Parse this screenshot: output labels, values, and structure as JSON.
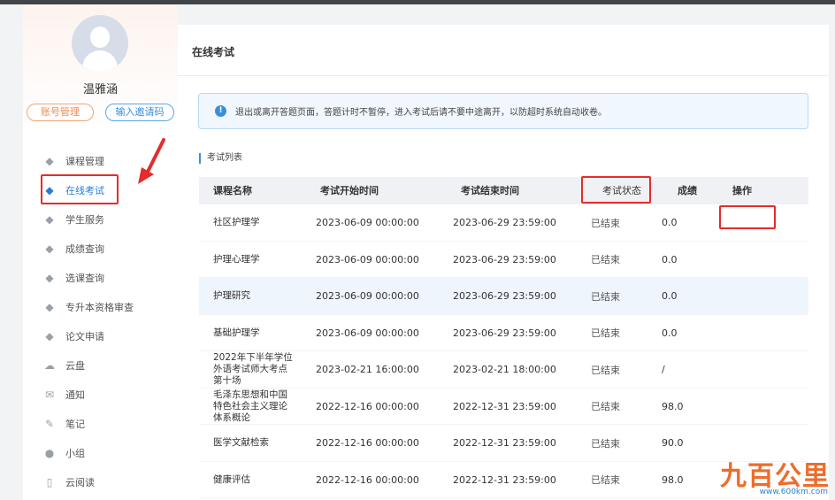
{
  "sidebar": {
    "username": "温雅涵",
    "account_button": "账号管理",
    "invite_button": "输入邀请码",
    "items": [
      {
        "label": "课程管理",
        "icon": "graduation-cap-icon",
        "active": false
      },
      {
        "label": "在线考试",
        "icon": "graduation-cap-icon",
        "active": true
      },
      {
        "label": "学生服务",
        "icon": "graduation-cap-icon",
        "active": false
      },
      {
        "label": "成绩查询",
        "icon": "graduation-cap-icon",
        "active": false
      },
      {
        "label": "选课查询",
        "icon": "graduation-cap-icon",
        "active": false
      },
      {
        "label": "专升本资格审查",
        "icon": "graduation-cap-icon",
        "active": false
      },
      {
        "label": "论文申请",
        "icon": "graduation-cap-icon",
        "active": false
      },
      {
        "label": "云盘",
        "icon": "cloud-icon",
        "active": false
      },
      {
        "label": "通知",
        "icon": "mail-icon",
        "active": false
      },
      {
        "label": "笔记",
        "icon": "note-icon",
        "active": false
      },
      {
        "label": "小组",
        "icon": "user-icon",
        "active": false
      },
      {
        "label": "云阅读",
        "icon": "book-icon",
        "active": false
      }
    ]
  },
  "main": {
    "title": "在线考试",
    "notice": "退出或离开答题页面，答题计时不暂停，进入考试后请不要中途离开，以防超时系统自动收卷。",
    "section_label": "考试列表",
    "columns": [
      "课程名称",
      "考试开始时间",
      "考试结束时间",
      "考试状态",
      "成绩",
      "操作"
    ],
    "rows": [
      {
        "name": "社区护理学",
        "start": "2023-06-09 00:00:00",
        "end": "2023-06-29 23:59:00",
        "status": "已结束",
        "score": "0.0"
      },
      {
        "name": "护理心理学",
        "start": "2023-06-09 00:00:00",
        "end": "2023-06-29 23:59:00",
        "status": "已结束",
        "score": "0.0"
      },
      {
        "name": "护理研究",
        "start": "2023-06-09 00:00:00",
        "end": "2023-06-29 23:59:00",
        "status": "已结束",
        "score": "0.0"
      },
      {
        "name": "基础护理学",
        "start": "2023-06-09 00:00:00",
        "end": "2023-06-29 23:59:00",
        "status": "已结束",
        "score": "0.0"
      },
      {
        "name": "2022年下半年学位外语考试师大考点第十场",
        "start": "2023-02-21 16:00:00",
        "end": "2023-02-21 18:00:00",
        "status": "已结束",
        "score": "/"
      },
      {
        "name": "毛泽东思想和中国特色社会主义理论体系概论",
        "start": "2022-12-16 00:00:00",
        "end": "2022-12-31 23:59:00",
        "status": "已结束",
        "score": "98.0"
      },
      {
        "name": "医学文献检索",
        "start": "2022-12-16 00:00:00",
        "end": "2022-12-31 23:59:00",
        "status": "已结束",
        "score": "90.0"
      },
      {
        "name": "健康评估",
        "start": "2022-12-16 00:00:00",
        "end": "2022-12-31 23:59:00",
        "status": "已结束",
        "score": "98.0"
      }
    ]
  },
  "watermark": {
    "brand": "九百公里",
    "url": "www.600km.com"
  },
  "colors": {
    "accent": "#2b7bd6",
    "highlight": "#e52b2b",
    "orange": "#f08a4c"
  }
}
